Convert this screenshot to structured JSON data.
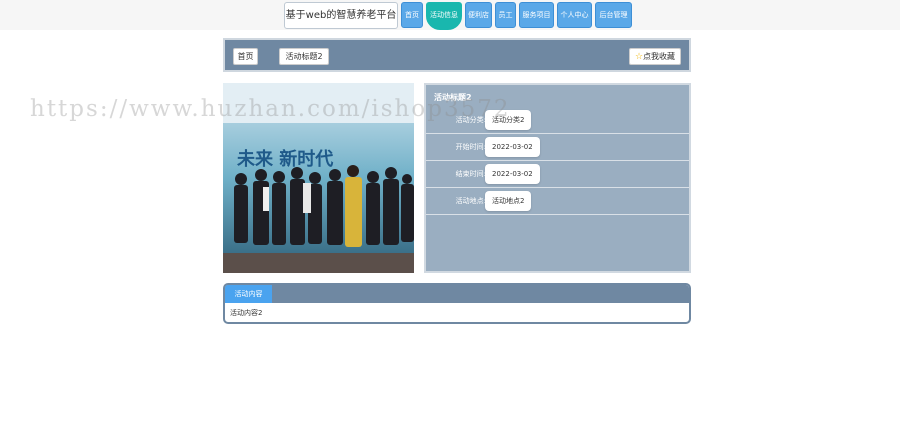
{
  "header": {
    "site_title": "基于web的智慧养老平台",
    "nav": [
      {
        "label": "首页"
      },
      {
        "label": "活动信息",
        "active": true
      },
      {
        "label": "便利店"
      },
      {
        "label": "员工"
      },
      {
        "label": "服务项目"
      },
      {
        "label": "个人中心"
      },
      {
        "label": "后台管理"
      }
    ],
    "accent_color": "#19b7ae",
    "nav_color": "#5aa8e8"
  },
  "breadcrumb": {
    "home": "首页",
    "current": "活动标题2",
    "favorite": "点我收藏",
    "favorite_icon": "star-icon"
  },
  "activity": {
    "title": "活动标题2",
    "fields": [
      {
        "label": "活动分类:",
        "value": "活动分类2"
      },
      {
        "label": "开始时间:",
        "value": "2022-03-02"
      },
      {
        "label": "结束时间:",
        "value": "2022-03-02"
      },
      {
        "label": "活动地点:",
        "value": "活动地点2"
      }
    ],
    "photo_caption": "未来 新时代"
  },
  "content": {
    "tab": "活动内容",
    "body": "活动内容2"
  },
  "watermark": "https://www.huzhan.com/ishop3572"
}
